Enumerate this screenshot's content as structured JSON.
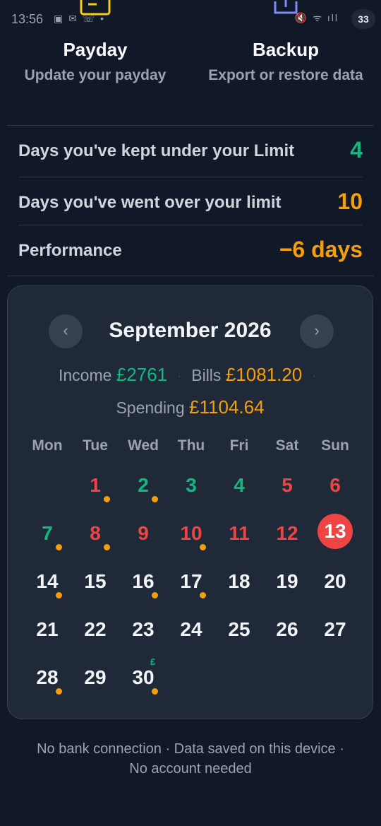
{
  "status_bar": {
    "time": "13:56",
    "battery": "33"
  },
  "actions": {
    "payday": {
      "title": "Payday",
      "subtitle": "Update your payday",
      "icon": "wallet-icon"
    },
    "backup": {
      "title": "Backup",
      "subtitle": "Export or restore data",
      "icon": "upload-icon"
    }
  },
  "stats": [
    {
      "label": "Days you've kept under your Limit",
      "value": "4",
      "color": "#10b981"
    },
    {
      "label": "Days you've went over your limit",
      "value": "10",
      "color": "#f59e0b"
    },
    {
      "label": "Performance",
      "value": "−6 days",
      "color": "#f59e0b"
    }
  ],
  "calendar": {
    "month": "September 2026",
    "prev_icon": "‹",
    "next_icon": "›",
    "income_label": "Income",
    "income_value": "£2761",
    "bills_label": "Bills",
    "bills_value": "£1081.20",
    "spending_label": "Spending",
    "spending_value": "£1104.64",
    "separator": "·",
    "weekdays": [
      "Mon",
      "Tue",
      "Wed",
      "Thu",
      "Fri",
      "Sat",
      "Sun"
    ],
    "first_weekday_offset": 1,
    "today": 13,
    "bill_marker": "£",
    "days": [
      {
        "n": "1",
        "status": "over",
        "dot": true
      },
      {
        "n": "2",
        "status": "under",
        "dot": true
      },
      {
        "n": "3",
        "status": "under",
        "dot": false
      },
      {
        "n": "4",
        "status": "under",
        "dot": false
      },
      {
        "n": "5",
        "status": "over",
        "dot": false
      },
      {
        "n": "6",
        "status": "over",
        "dot": false
      },
      {
        "n": "7",
        "status": "under",
        "dot": true
      },
      {
        "n": "8",
        "status": "over",
        "dot": true
      },
      {
        "n": "9",
        "status": "over",
        "dot": false
      },
      {
        "n": "10",
        "status": "over",
        "dot": true
      },
      {
        "n": "11",
        "status": "over",
        "dot": false
      },
      {
        "n": "12",
        "status": "over",
        "dot": false
      },
      {
        "n": "13",
        "status": "today",
        "dot": false
      },
      {
        "n": "14",
        "status": "future",
        "dot": true
      },
      {
        "n": "15",
        "status": "future",
        "dot": false
      },
      {
        "n": "16",
        "status": "future",
        "dot": true
      },
      {
        "n": "17",
        "status": "future",
        "dot": true
      },
      {
        "n": "18",
        "status": "future",
        "dot": false
      },
      {
        "n": "19",
        "status": "future",
        "dot": false
      },
      {
        "n": "20",
        "status": "future",
        "dot": false
      },
      {
        "n": "21",
        "status": "future",
        "dot": false
      },
      {
        "n": "22",
        "status": "future",
        "dot": false
      },
      {
        "n": "23",
        "status": "future",
        "dot": false
      },
      {
        "n": "24",
        "status": "future",
        "dot": false
      },
      {
        "n": "25",
        "status": "future",
        "dot": false
      },
      {
        "n": "26",
        "status": "future",
        "dot": false
      },
      {
        "n": "27",
        "status": "future",
        "dot": false
      },
      {
        "n": "28",
        "status": "future",
        "dot": true
      },
      {
        "n": "29",
        "status": "future",
        "dot": false
      },
      {
        "n": "30",
        "status": "future",
        "dot": true,
        "bill": true
      }
    ]
  },
  "colors": {
    "under": "#10b981",
    "over": "#ef4444",
    "future": "#f3f4f6",
    "income": "#10b981",
    "bills": "#f59e0b",
    "spending": "#f59e0b"
  },
  "footer": {
    "line1": "No bank connection · Data saved on this device ·",
    "line2": "No account needed"
  }
}
